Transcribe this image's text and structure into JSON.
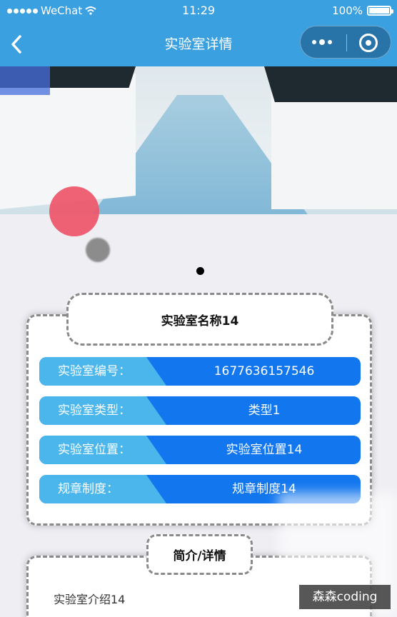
{
  "status_bar": {
    "carrier": "WeChat",
    "time": "11:29",
    "battery": "100%"
  },
  "nav": {
    "title": "实验室详情",
    "back_icon": "chevron-left-icon",
    "more_icon": "more-dots-icon",
    "close_icon": "target-circle-icon"
  },
  "banner": {
    "image_alt": "laboratory-photo"
  },
  "lab": {
    "name": "实验室名称14",
    "rows": [
      {
        "label": "实验室编号：",
        "value": "1677636157546"
      },
      {
        "label": "实验室类型：",
        "value": "类型1"
      },
      {
        "label": "实验室位置：",
        "value": "实验室位置14"
      },
      {
        "label": "规章制度：",
        "value": "规章制度14"
      }
    ]
  },
  "intro": {
    "title": "简介/详情",
    "text": "实验室介绍14"
  },
  "watermark": "森森coding",
  "colors": {
    "nav_bg": "#3aa0df",
    "label_bg": "#4ab6eb",
    "value_bg": "#1276ee",
    "touch_dot": "#ee5569"
  }
}
